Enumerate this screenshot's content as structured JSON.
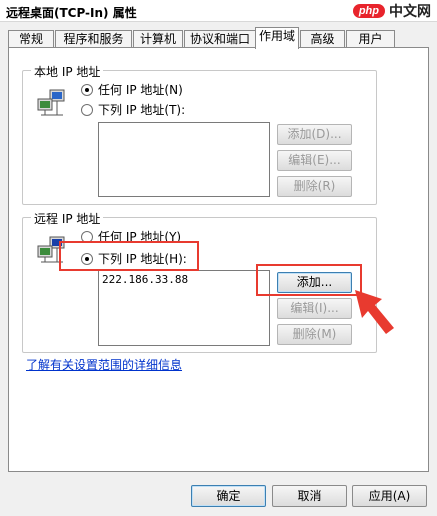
{
  "window": {
    "title": "远程桌面(TCP-In) 属性"
  },
  "watermark": {
    "logo": "php",
    "site": "中文网"
  },
  "tabs": [
    {
      "label": "常规"
    },
    {
      "label": "程序和服务"
    },
    {
      "label": "计算机"
    },
    {
      "label": "协议和端口"
    },
    {
      "label": "作用域",
      "active": true
    },
    {
      "label": "高级"
    },
    {
      "label": "用户"
    }
  ],
  "local": {
    "title": "本地 IP 地址",
    "option_any": "任何 IP 地址(N)",
    "option_list": "下列 IP 地址(T):",
    "selected": "any",
    "entries": [],
    "add": "添加(D)...",
    "edit": "编辑(E)...",
    "remove": "删除(R)"
  },
  "remote": {
    "title": "远程 IP 地址",
    "option_any": "任何 IP 地址(Y)",
    "option_list": "下列 IP 地址(H):",
    "selected": "list",
    "entries": [
      "222.186.33.88"
    ],
    "add": "添加...",
    "edit": "编辑(I)...",
    "remove": "删除(M)"
  },
  "link": "了解有关设置范围的详细信息",
  "footer": {
    "ok": "确定",
    "cancel": "取消",
    "apply": "应用(A)"
  },
  "colors": {
    "highlight": "#e83a2f",
    "link": "#0033cc"
  }
}
